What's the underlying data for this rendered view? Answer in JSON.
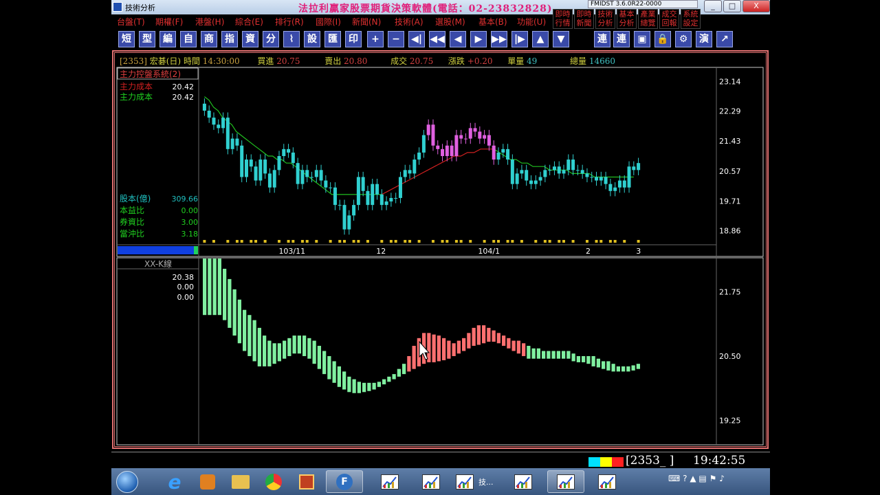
{
  "window": {
    "title": "技術分析",
    "marquee": "法拉利贏家股票期貨決策軟體(電話：02-23832828)",
    "version": "FMIDST 3.6.0R22-0000",
    "controls": [
      "_",
      "□",
      "X"
    ]
  },
  "menu": [
    {
      "label": "台盤(T)"
    },
    {
      "label": "期權(F)"
    },
    {
      "label": "港盤(H)"
    },
    {
      "label": "綜合(E)"
    },
    {
      "label": "排行(R)"
    },
    {
      "label": "國際(I)"
    },
    {
      "label": "新聞(N)"
    },
    {
      "label": "技術(A)"
    },
    {
      "label": "選股(M)"
    },
    {
      "label": "基本(B)"
    },
    {
      "label": "功能(U)"
    }
  ],
  "right_menu": [
    {
      "label": "即時\n行情"
    },
    {
      "label": "即時\n新聞"
    },
    {
      "label": "技術\n分析"
    },
    {
      "label": "基本\n分析"
    },
    {
      "label": "產業\n總覽"
    },
    {
      "label": "成交\n回報"
    },
    {
      "label": "系統\n設定"
    }
  ],
  "toolbar": [
    "短",
    "型",
    "編",
    "自",
    "商",
    "指",
    "資",
    "分",
    "⌇",
    "設",
    "匯",
    "印",
    "+",
    "−",
    "◀|",
    "◀◀",
    "◀",
    "▶",
    "▶▶",
    "|▶",
    "▲",
    "▼",
    "連",
    "連",
    "▣",
    "🔒",
    "⚙",
    "演",
    "↗"
  ],
  "quote": {
    "code": "[2353]",
    "name": "宏碁(日)",
    "time_label": "時間",
    "time": "14:30:00",
    "bid_label": "買進",
    "bid": "20.75",
    "ask_label": "賣出",
    "ask": "20.80",
    "deal_label": "成交",
    "deal": "20.75",
    "change_label": "漲跌",
    "change": "+0.20",
    "vol_label": "單量",
    "vol": "49",
    "total_label": "總量",
    "total": "14660"
  },
  "panel1": {
    "title": "主力控盤系統(2)",
    "rows": [
      {
        "label": "主力成本",
        "value": "20.42",
        "color": "#d02020"
      },
      {
        "label": "主力成本",
        "value": "20.42",
        "color": "#20d020"
      }
    ],
    "stats": [
      {
        "label": "股本(億)",
        "value": "309.66"
      },
      {
        "label": "本益比",
        "value": "0.00"
      },
      {
        "label": "券資比",
        "value": "3.00"
      },
      {
        "label": "當沖比",
        "value": "3.18"
      }
    ],
    "y_ticks": [
      "23.14",
      "22.29",
      "21.43",
      "20.57",
      "19.71",
      "18.86"
    ],
    "x_ticks": [
      "103/11",
      "12",
      "104/1",
      "2",
      "3"
    ]
  },
  "panel2": {
    "title": "XX-K線",
    "values": [
      "20.38",
      "0.00",
      "0.00"
    ],
    "y_ticks": [
      "21.75",
      "20.50",
      "19.25"
    ]
  },
  "status": {
    "code": "[2353_  ]",
    "time": "19:42:55",
    "colors": [
      "#00e0ff",
      "#ffff00",
      "#ff2020"
    ]
  },
  "taskbar": {
    "apps": [
      "start-orb",
      "ie-browser",
      "media-player",
      "file-explorer",
      "chrome",
      "app",
      "fmidst",
      "chart-app",
      "chart-app",
      "chart-app-技",
      "chart-app",
      "chart-app",
      "chart-app"
    ],
    "active_label": "技..."
  },
  "chart_data": [
    {
      "type": "candlestick",
      "title": "主力控盤系統(2)",
      "x_ticks": [
        "103/11",
        "12",
        "104/1",
        "2",
        "3"
      ],
      "ylim": [
        18.5,
        23.5
      ],
      "y_ticks": [
        23.14,
        22.29,
        21.43,
        20.57,
        19.71,
        18.86
      ],
      "close": [
        22.3,
        22.1,
        21.9,
        21.8,
        22.1,
        21.2,
        21.5,
        21.3,
        20.4,
        20.9,
        20.7,
        20.3,
        20.9,
        20.5,
        20.1,
        20.6,
        21.0,
        21.2,
        21.1,
        20.8,
        20.2,
        20.6,
        20.4,
        20.4,
        20.6,
        20.3,
        20.1,
        20.1,
        19.6,
        19.6,
        18.9,
        19.3,
        19.6,
        20.4,
        20.0,
        19.6,
        20.2,
        19.9,
        19.6,
        19.7,
        19.8,
        19.8,
        20.4,
        20.6,
        20.5,
        20.9,
        21.1,
        21.6,
        21.9,
        21.3,
        21.2,
        21.0,
        21.3,
        21.0,
        21.6,
        21.5,
        21.5,
        21.8,
        21.7,
        21.5,
        21.6,
        21.3,
        20.9,
        21.1,
        21.2,
        20.9,
        20.2,
        20.5,
        20.6,
        20.3,
        20.2,
        20.3,
        20.4,
        20.6,
        20.6,
        20.7,
        20.5,
        20.6,
        20.9,
        20.6,
        20.6,
        20.5,
        20.4,
        20.4,
        20.3,
        20.4,
        20.2,
        20.0,
        20.1,
        20.3,
        20.1,
        20.7,
        20.6,
        20.8
      ],
      "ma_series": [
        {
          "color": "#20c020",
          "values": [
            22.7,
            22.6,
            22.4,
            22.3,
            22.1,
            22.0,
            21.9,
            21.7,
            21.6,
            21.5,
            21.4,
            21.3,
            21.2,
            21.1,
            21.0,
            21.0,
            20.9,
            20.9,
            20.8,
            20.8,
            20.7,
            20.6,
            20.5,
            20.4,
            20.3,
            20.2,
            20.1,
            20.0,
            19.9,
            19.9,
            19.9,
            19.9,
            19.9,
            19.9,
            19.9,
            19.9,
            19.9,
            19.9,
            19.9,
            19.9
          ]
        },
        {
          "color": "#d02020",
          "values": [
            19.9,
            20.0,
            20.1,
            20.2,
            20.3,
            20.4,
            20.5,
            20.6,
            20.7,
            20.8,
            20.9,
            21.0,
            21.0,
            21.1,
            21.1,
            21.2,
            21.2,
            21.2
          ]
        },
        {
          "color": "#20c020",
          "values": [
            21.2,
            21.1,
            21.0,
            20.9,
            20.9,
            20.8,
            20.8,
            20.7,
            20.7,
            20.7,
            20.6,
            20.6,
            20.6,
            20.6,
            20.5,
            20.5,
            20.5,
            20.5,
            20.4,
            20.4,
            20.4,
            20.4,
            20.4,
            20.4,
            20.4,
            20.4
          ]
        }
      ]
    },
    {
      "type": "bar",
      "title": "XX-K線",
      "ylim": [
        18.8,
        22.4
      ],
      "y_ticks": [
        21.75,
        20.5,
        19.25
      ],
      "upper": [
        22.4,
        22.4,
        22.4,
        22.4,
        22.2,
        22.0,
        21.8,
        21.6,
        21.4,
        21.3,
        21.2,
        21.05,
        20.9,
        20.8,
        20.75,
        20.75,
        20.8,
        20.85,
        20.9,
        20.9,
        20.9,
        20.85,
        20.8,
        20.7,
        20.6,
        20.5,
        20.4,
        20.3,
        20.2,
        20.1,
        20.05,
        20.0,
        19.98,
        19.98,
        19.98,
        20.0,
        20.05,
        20.1,
        20.15,
        20.25,
        20.35,
        20.5,
        20.7,
        20.85,
        20.95,
        20.95,
        20.92,
        20.9,
        20.85,
        20.8,
        20.75,
        20.8,
        20.85,
        20.95,
        21.05,
        21.1,
        21.1,
        21.05,
        21.0,
        20.95,
        20.9,
        20.85,
        20.8,
        20.8,
        20.75,
        20.7,
        20.65,
        20.65,
        20.6,
        20.6,
        20.6,
        20.6,
        20.6,
        20.6,
        20.55,
        20.5,
        20.5,
        20.5,
        20.5,
        20.45,
        20.4,
        20.4,
        20.35,
        20.3,
        20.3,
        20.3,
        20.32,
        20.35
      ],
      "lower": [
        21.3,
        21.3,
        21.3,
        21.3,
        21.2,
        21.05,
        20.9,
        20.75,
        20.6,
        20.5,
        20.4,
        20.3,
        20.3,
        20.3,
        20.35,
        20.4,
        20.45,
        20.5,
        20.55,
        20.55,
        20.5,
        20.45,
        20.35,
        20.25,
        20.15,
        20.05,
        19.98,
        19.9,
        19.85,
        19.8,
        19.78,
        19.78,
        19.8,
        19.82,
        19.85,
        19.9,
        19.95,
        20.0,
        20.05,
        20.1,
        20.15,
        20.2,
        20.25,
        20.3,
        20.35,
        20.38,
        20.38,
        20.4,
        20.42,
        20.45,
        20.5,
        20.55,
        20.6,
        20.65,
        20.7,
        20.72,
        20.75,
        20.78,
        20.78,
        20.75,
        20.7,
        20.65,
        20.6,
        20.55,
        20.5,
        20.45,
        20.45,
        20.45,
        20.45,
        20.45,
        20.45,
        20.45,
        20.45,
        20.45,
        20.4,
        20.38,
        20.38,
        20.35,
        20.3,
        20.28,
        20.25,
        20.22,
        20.2,
        20.2,
        20.2,
        20.2,
        20.22,
        20.25
      ],
      "bar_colors": [
        "#80f0a0",
        "#ff7070"
      ]
    }
  ]
}
